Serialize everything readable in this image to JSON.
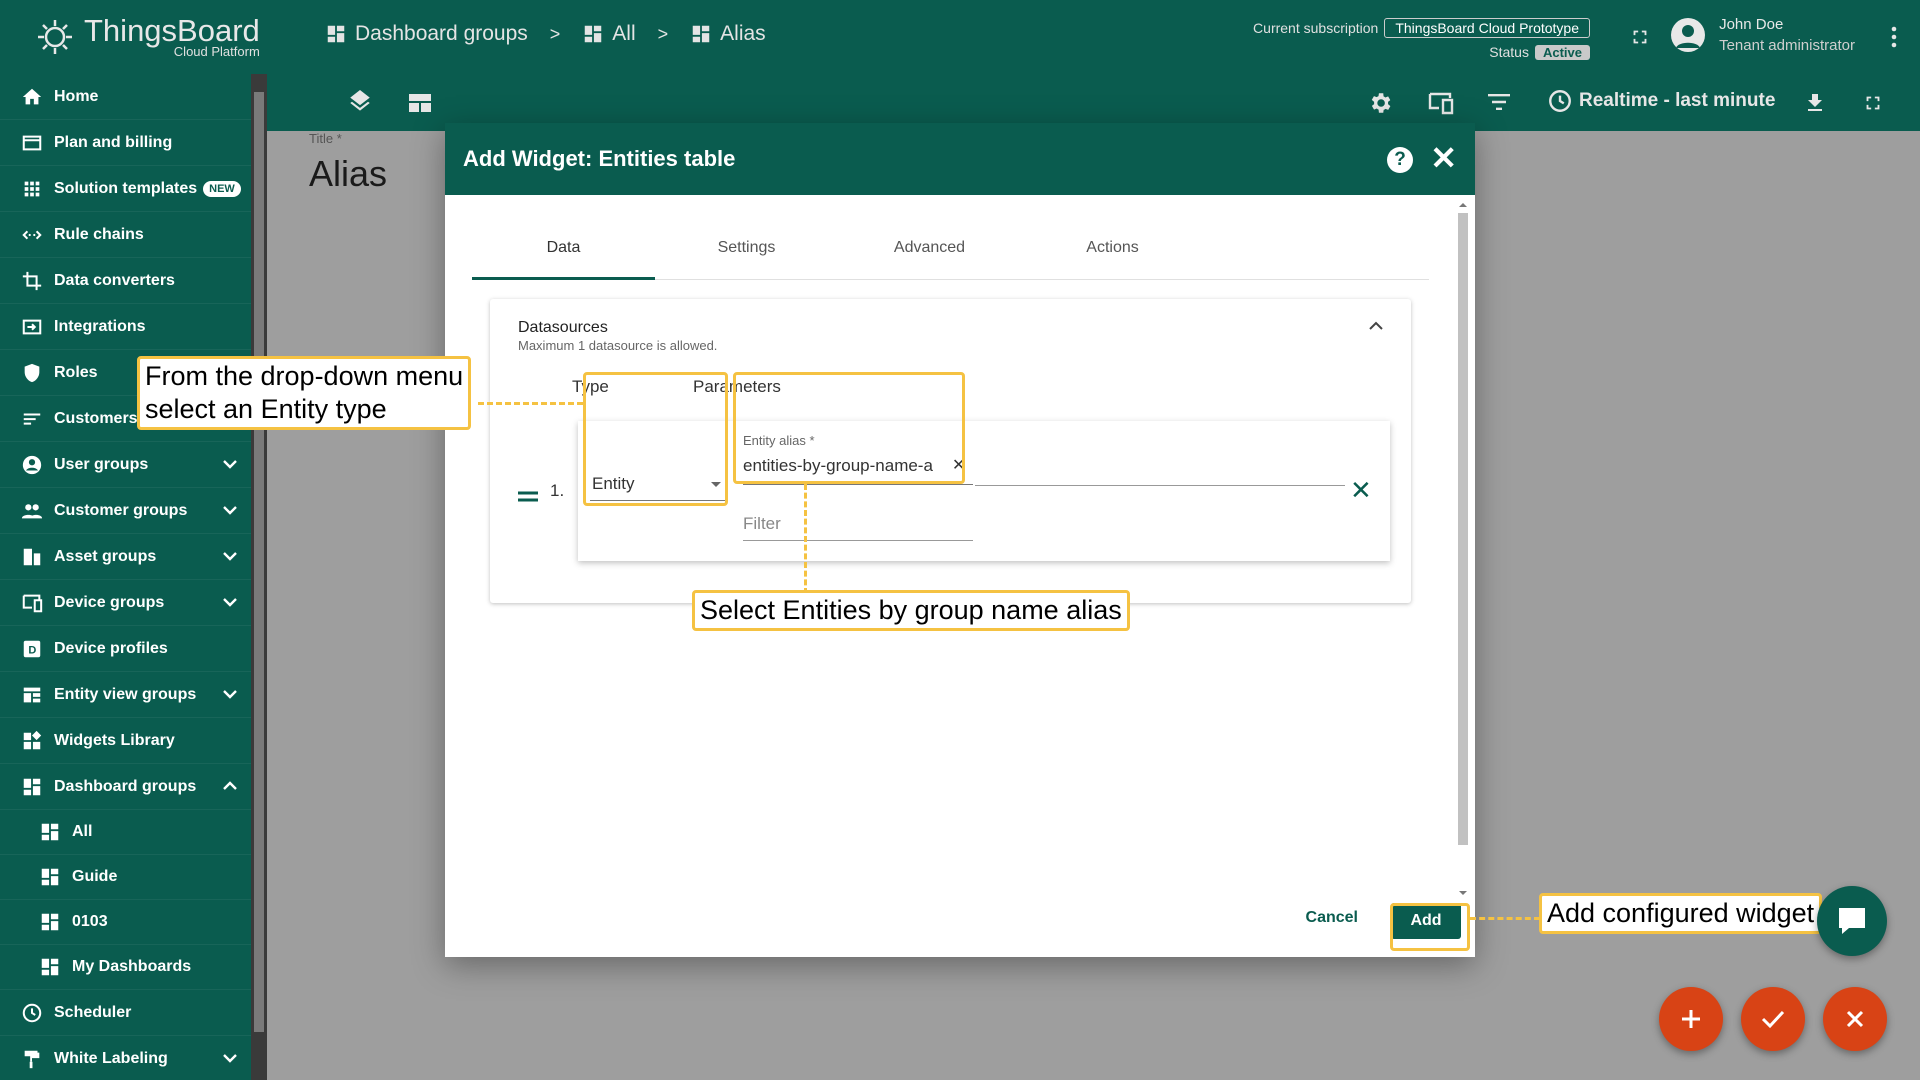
{
  "app": {
    "name": "ThingsBoard",
    "subtitle": "Cloud Platform"
  },
  "sidebar": {
    "items": [
      {
        "label": "Home",
        "icon": "home-icon"
      },
      {
        "label": "Plan and billing",
        "icon": "billing-icon"
      },
      {
        "label": "Solution templates",
        "icon": "apps-icon",
        "badge": "NEW"
      },
      {
        "label": "Rule chains",
        "icon": "rule-chain-icon"
      },
      {
        "label": "Data converters",
        "icon": "converter-icon"
      },
      {
        "label": "Integrations",
        "icon": "integration-icon"
      },
      {
        "label": "Roles",
        "icon": "shield-icon"
      },
      {
        "label": "Customers",
        "icon": "customers-icon"
      },
      {
        "label": "User groups",
        "icon": "user-icon",
        "expandable": true
      },
      {
        "label": "Customer groups",
        "icon": "people-icon",
        "expandable": true
      },
      {
        "label": "Asset groups",
        "icon": "asset-icon",
        "expandable": true
      },
      {
        "label": "Device groups",
        "icon": "device-icon",
        "expandable": true
      },
      {
        "label": "Device profiles",
        "icon": "device-profile-icon"
      },
      {
        "label": "Entity view groups",
        "icon": "entity-view-icon",
        "expandable": true
      },
      {
        "label": "Widgets Library",
        "icon": "widgets-icon"
      },
      {
        "label": "Dashboard groups",
        "icon": "dashboard-icon",
        "expanded": true
      },
      {
        "label": "All",
        "icon": "dashboard-icon",
        "child": true
      },
      {
        "label": "Guide",
        "icon": "dashboard-icon",
        "child": true
      },
      {
        "label": "0103",
        "icon": "dashboard-icon",
        "child": true
      },
      {
        "label": "My Dashboards",
        "icon": "dashboard-icon",
        "child": true
      },
      {
        "label": "Scheduler",
        "icon": "clock-icon"
      },
      {
        "label": "White Labeling",
        "icon": "paint-roller-icon",
        "expandable": true
      }
    ]
  },
  "header": {
    "breadcrumbs": [
      "Dashboard groups",
      "All",
      "Alias"
    ],
    "separator": ">",
    "subscription_label": "Current subscription",
    "subscription_value": "ThingsBoard Cloud Prototype",
    "status_label": "Status",
    "status_value": "Active",
    "user_name": "John Doe",
    "user_role": "Tenant administrator"
  },
  "toolbar": {
    "timewindow": "Realtime - last minute"
  },
  "dashboard": {
    "title_label": "Title *",
    "title": "Alias"
  },
  "dialog": {
    "title": "Add Widget: Entities table",
    "tabs": [
      "Data",
      "Settings",
      "Advanced",
      "Actions"
    ],
    "datasources_title": "Datasources",
    "datasources_hint": "Maximum 1 datasource is allowed.",
    "col_type": "Type",
    "col_params": "Parameters",
    "row_number": "1.",
    "type_value": "Entity",
    "alias_label": "Entity alias *",
    "alias_value": "entities-by-group-name-a",
    "filter_placeholder": "Filter",
    "cancel": "Cancel",
    "add": "Add"
  },
  "callouts": {
    "type": "From the drop-down menu\nselect an Entity type",
    "alias": "Select Entities by group name alias",
    "add": "Add configured widget"
  },
  "colors": {
    "primary": "#0a5c4f",
    "accent": "#d84315",
    "highlight": "#f5c242"
  }
}
